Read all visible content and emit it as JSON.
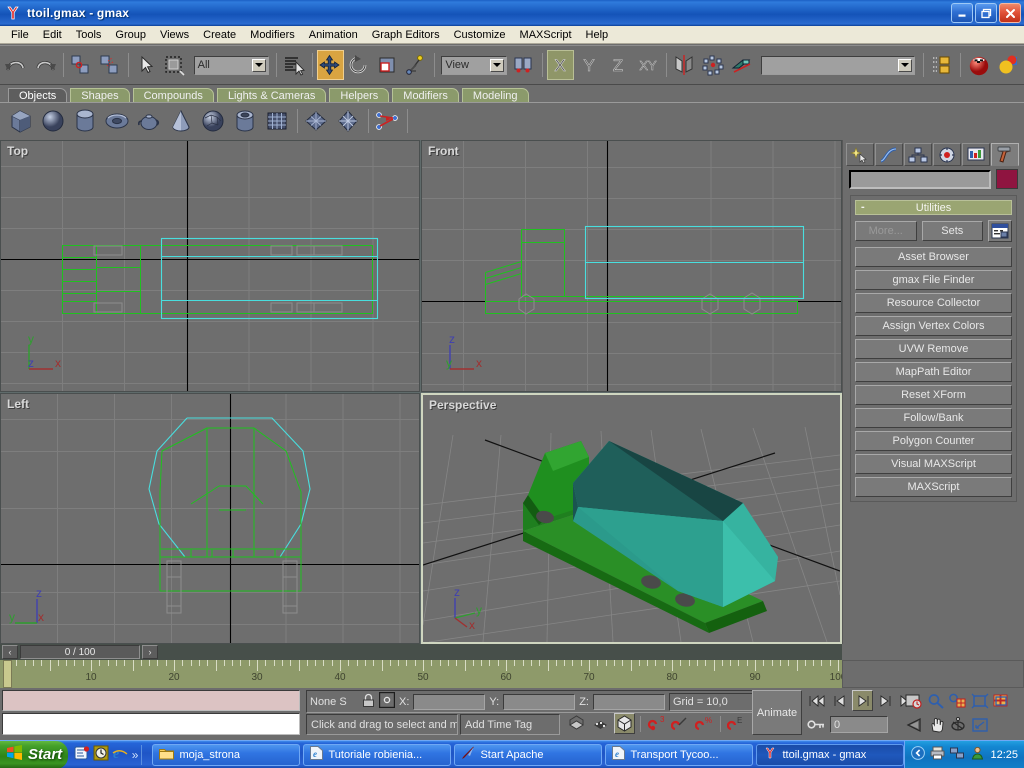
{
  "window": {
    "title": "ttoil.gmax - gmax",
    "app_icon": "gmax-icon",
    "minimize_label": "_",
    "maximize_label": "❐",
    "close_label": "✕"
  },
  "menubar": {
    "items": [
      {
        "label": "File"
      },
      {
        "label": "Edit"
      },
      {
        "label": "Tools"
      },
      {
        "label": "Group"
      },
      {
        "label": "Views"
      },
      {
        "label": "Create"
      },
      {
        "label": "Modifiers"
      },
      {
        "label": "Animation"
      },
      {
        "label": "Graph Editors"
      },
      {
        "label": "Customize"
      },
      {
        "label": "MAXScript"
      },
      {
        "label": "Help"
      }
    ]
  },
  "toolbar": {
    "selection_filter": "All",
    "reference_coord_system": "View",
    "named_selection_sets": "",
    "buttons": [
      {
        "name": "undo-button",
        "icon": "undo-arrow-icon"
      },
      {
        "name": "redo-button",
        "icon": "redo-arrow-icon"
      },
      {
        "name": "select-and-link-button",
        "icon": "link-icon"
      },
      {
        "name": "unlink-selection-button",
        "icon": "unlink-icon"
      },
      {
        "name": "select-object-button",
        "icon": "arrow-cursor-icon"
      },
      {
        "name": "select-region-button",
        "icon": "rectangular-marquee-icon"
      },
      {
        "name": "select-by-name-button",
        "icon": "select-by-name-icon"
      },
      {
        "name": "select-and-move-button",
        "icon": "move-gizmo-icon"
      },
      {
        "name": "select-and-rotate-button",
        "icon": "rotate-gizmo-icon"
      },
      {
        "name": "select-and-scale-button",
        "icon": "scale-gizmo-icon"
      },
      {
        "name": "manipulate-button",
        "icon": "manipulate-icon"
      },
      {
        "name": "restrict-to-x-button",
        "icon": "axis-x-icon",
        "label": "X"
      },
      {
        "name": "restrict-to-y-button",
        "icon": "axis-y-icon",
        "label": "Y"
      },
      {
        "name": "restrict-to-z-button",
        "icon": "axis-z-icon",
        "label": "Z"
      },
      {
        "name": "restrict-to-plane-button",
        "icon": "axis-xy-icon",
        "label": "XY"
      },
      {
        "name": "mirror-button",
        "icon": "mirror-icon"
      },
      {
        "name": "align-button",
        "icon": "align-icon"
      },
      {
        "name": "array-button",
        "icon": "array-icon"
      },
      {
        "name": "layer-manager-button",
        "icon": "layers-icon"
      },
      {
        "name": "material-editor-button",
        "icon": "material-sphere-icon"
      },
      {
        "name": "render-scene-button",
        "icon": "render-spheres-icon"
      }
    ]
  },
  "command_tabs": {
    "items": [
      {
        "label": "Objects",
        "selected": true
      },
      {
        "label": "Shapes",
        "selected": false
      },
      {
        "label": "Compounds",
        "selected": false
      },
      {
        "label": "Lights & Cameras",
        "selected": false
      },
      {
        "label": "Helpers",
        "selected": false
      },
      {
        "label": "Modifiers",
        "selected": false
      },
      {
        "label": "Modeling",
        "selected": false
      }
    ]
  },
  "object_buttons": [
    {
      "name": "box-primitive-button",
      "icon": "box-icon"
    },
    {
      "name": "sphere-primitive-button",
      "icon": "sphere-icon"
    },
    {
      "name": "cylinder-primitive-button",
      "icon": "cylinder-icon"
    },
    {
      "name": "torus-primitive-button",
      "icon": "torus-icon"
    },
    {
      "name": "teapot-primitive-button",
      "icon": "teapot-icon"
    },
    {
      "name": "cone-primitive-button",
      "icon": "cone-icon"
    },
    {
      "name": "geosphere-primitive-button",
      "icon": "geosphere-icon"
    },
    {
      "name": "tube-primitive-button",
      "icon": "tube-icon"
    },
    {
      "name": "plane-primitive-button",
      "icon": "plane-grid-icon"
    },
    {
      "name": "patch-grid-button",
      "icon": "quad-patch-icon"
    },
    {
      "name": "tri-patch-button",
      "icon": "tri-patch-icon"
    },
    {
      "name": "particle-systems-button",
      "icon": "particle-icon"
    }
  ],
  "viewports": [
    {
      "name": "viewport-top",
      "label": "Top",
      "active": false,
      "tripod": {
        "up": "y",
        "up_color": "#2f9e2f",
        "right": "x",
        "right_color": "#a03030",
        "third": "z",
        "third_color": "#4040b0"
      }
    },
    {
      "name": "viewport-front",
      "label": "Front",
      "active": false,
      "tripod": {
        "up": "z",
        "up_color": "#4040b0",
        "right": "x",
        "right_color": "#a03030",
        "third": "y",
        "third_color": "#2f9e2f"
      }
    },
    {
      "name": "viewport-left",
      "label": "Left",
      "active": false,
      "tripod": {
        "up": "z",
        "up_color": "#4040b0",
        "right": "x",
        "right_color": "#a03030",
        "third": "y",
        "third_color": "#2f9e2f"
      }
    },
    {
      "name": "viewport-perspective",
      "label": "Perspective",
      "active": true,
      "tripod": {
        "up": "z",
        "up_color": "#4040b0",
        "right": "y",
        "right_color": "#2f9e2f",
        "third": "x",
        "third_color": "#a03030"
      }
    }
  ],
  "command_panel": {
    "tabs": [
      {
        "name": "create-tab",
        "icon": "create-star-icon",
        "selected": false
      },
      {
        "name": "modify-tab",
        "icon": "modify-curve-icon",
        "selected": false
      },
      {
        "name": "hierarchy-tab",
        "icon": "hierarchy-nodes-icon",
        "selected": false
      },
      {
        "name": "motion-tab",
        "icon": "motion-wheel-icon",
        "selected": false
      },
      {
        "name": "display-tab",
        "icon": "display-monitor-icon",
        "selected": false
      },
      {
        "name": "utilities-tab",
        "icon": "hammer-icon",
        "selected": true
      }
    ],
    "object_name": "",
    "object_color": "#8f1440",
    "rollout": {
      "title": "Utilities",
      "collapse_symbol": "-",
      "more_label": "More...",
      "sets_label": "Sets",
      "configure_icon": "configure-button-sets-icon",
      "buttons": [
        {
          "label": "Asset Browser"
        },
        {
          "label": "gmax File Finder"
        },
        {
          "label": "Resource Collector"
        },
        {
          "label": "Assign Vertex Colors"
        },
        {
          "label": "UVW Remove"
        },
        {
          "label": "MapPath Editor"
        },
        {
          "label": "Reset XForm"
        },
        {
          "label": "Follow/Bank"
        },
        {
          "label": "Polygon Counter"
        },
        {
          "label": "Visual MAXScript"
        },
        {
          "label": "MAXScript"
        }
      ]
    }
  },
  "timeline": {
    "current_frame_label": "0 / 100",
    "prev_label": "‹",
    "next_label": "›",
    "ticks": [
      10,
      20,
      30,
      40,
      50,
      60,
      70,
      80,
      90,
      100
    ],
    "range_start": 0,
    "range_end": 100
  },
  "statusbar": {
    "listener_top_value": "",
    "listener_bottom_value": "",
    "selection_count": "None S",
    "lock_icon": "selection-lock-icon",
    "absolute_mode_icon": "absolute-relative-transform-icon",
    "coords": [
      {
        "axis": "X:",
        "value": ""
      },
      {
        "axis": "Y:",
        "value": ""
      },
      {
        "axis": "Z:",
        "value": ""
      }
    ],
    "grid_label": "Grid = 10,0",
    "prompt_text": "Click and drag to select and m",
    "add_time_tag_label": "Add Time Tag",
    "animate_label": "Animate",
    "key_mode_icon": "key-mode-icon",
    "key_field_value": "0",
    "snap_toggles": [
      {
        "name": "snap-toggle-2d-icon"
      },
      {
        "name": "angle-snap-toggle-icon"
      },
      {
        "name": "snap-toggle-3d-icon",
        "active": true
      },
      {
        "name": "percent-snap-icon"
      },
      {
        "name": "spinner-snap-icon"
      }
    ],
    "playback_buttons": [
      {
        "name": "go-to-start-button",
        "icon": "skip-start-icon"
      },
      {
        "name": "previous-frame-button",
        "icon": "step-back-icon"
      },
      {
        "name": "play-animation-button",
        "icon": "play-icon"
      },
      {
        "name": "next-frame-button",
        "icon": "step-forward-icon"
      },
      {
        "name": "go-to-end-button",
        "icon": "skip-end-icon"
      }
    ],
    "viewport_nav": [
      {
        "name": "zoom-button",
        "icon": "magnifier-icon"
      },
      {
        "name": "zoom-all-button",
        "icon": "zoom-all-icon"
      },
      {
        "name": "zoom-extents-button",
        "icon": "zoom-extents-icon"
      },
      {
        "name": "zoom-extents-all-button",
        "icon": "zoom-extents-all-icon"
      },
      {
        "name": "field-of-view-button",
        "icon": "field-of-view-icon"
      },
      {
        "name": "pan-button",
        "icon": "hand-pan-icon"
      },
      {
        "name": "arc-rotate-button",
        "icon": "arc-rotate-icon"
      },
      {
        "name": "min-max-toggle-button",
        "icon": "min-max-toggle-icon"
      }
    ]
  },
  "taskbar": {
    "start_label": "Start",
    "quicklaunch": [
      {
        "name": "quicklaunch-outlook-icon"
      },
      {
        "name": "quicklaunch-clock-icon"
      },
      {
        "name": "quicklaunch-ie-icon"
      },
      {
        "name": "quicklaunch-overflow-chevrons",
        "label": "»"
      }
    ],
    "tasks": [
      {
        "label": "moja_strona",
        "icon": "folder-icon",
        "selected": false
      },
      {
        "label": "Tutoriale robienia...",
        "icon": "ie-document-icon",
        "selected": false
      },
      {
        "label": "Start Apache",
        "icon": "apache-feather-icon",
        "selected": false
      },
      {
        "label": "Transport Tycoo...",
        "icon": "ie-document-icon",
        "selected": false
      },
      {
        "label": "ttoil.gmax - gmax",
        "icon": "gmax-icon",
        "selected": true
      }
    ],
    "tray": {
      "icons": [
        {
          "name": "show-hidden-icons-chevron"
        },
        {
          "name": "tray-printer-icon"
        },
        {
          "name": "tray-network-icon"
        },
        {
          "name": "tray-user-icon"
        }
      ],
      "clock": "12:25"
    }
  }
}
